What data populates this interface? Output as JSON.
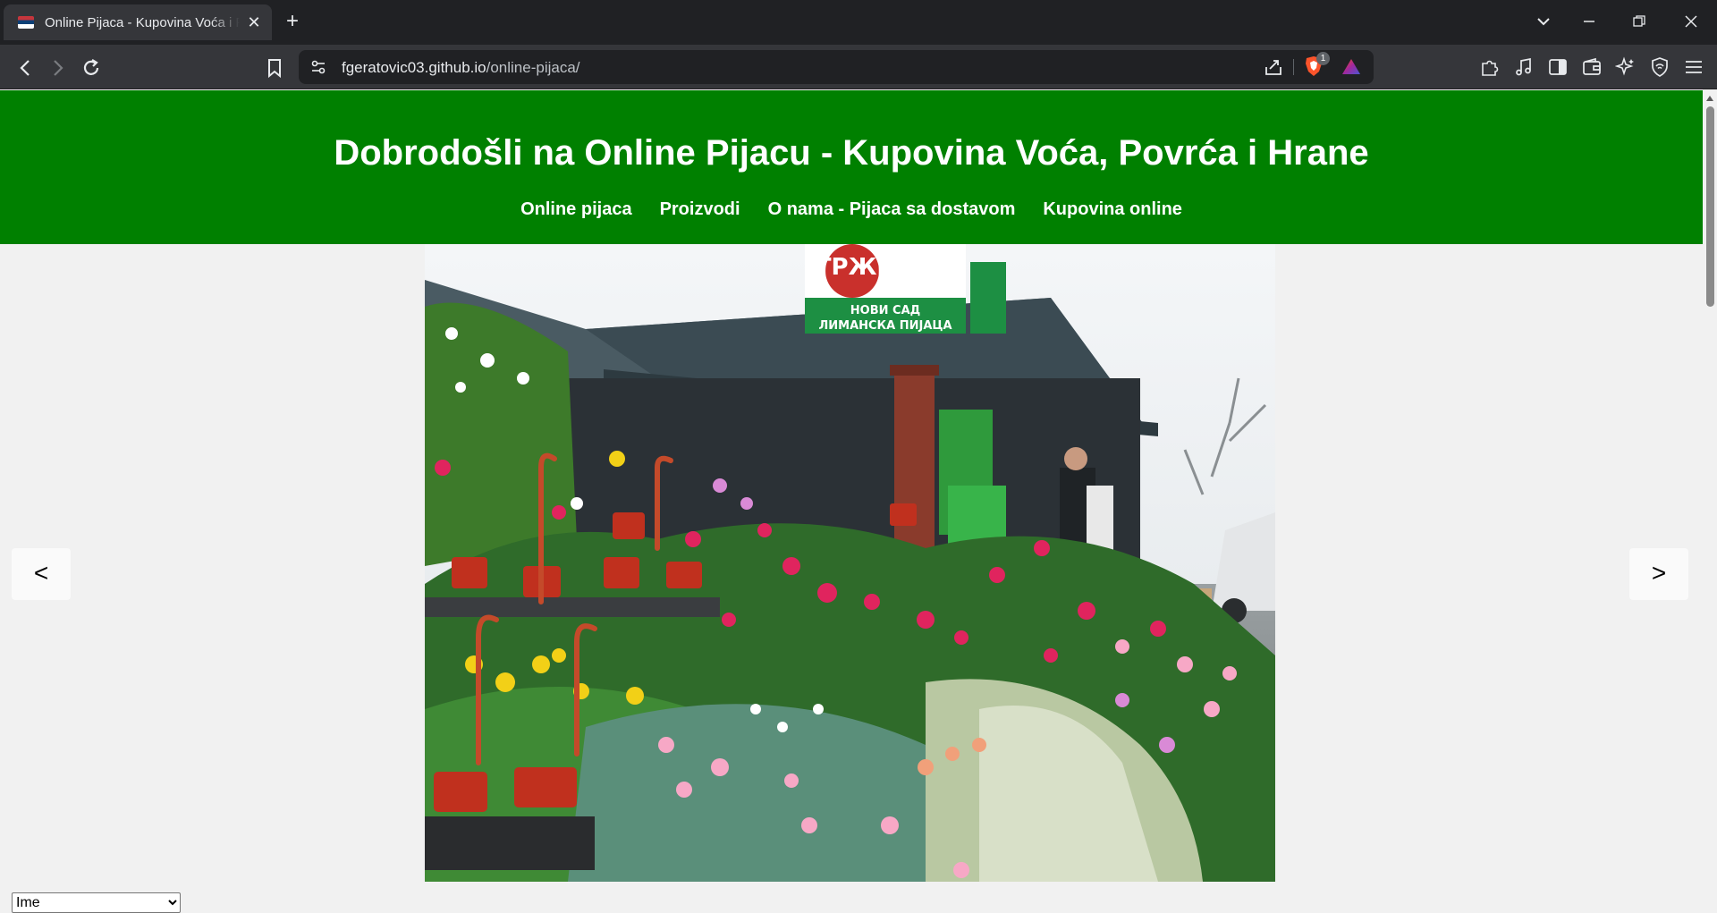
{
  "browser": {
    "tab_title": "Online Pijaca - Kupovina Voća i Povrća i Hrane",
    "tab_close": "✕",
    "new_tab": "+",
    "url_host": "fgeratovic03.github.io",
    "url_path": "/online-pijaca/",
    "shield_count": "1",
    "nav_back": "‹",
    "nav_forward": "›",
    "reload": "↻",
    "tab_list": "⌄",
    "minimize": "—",
    "restore": "❐",
    "close": "✕"
  },
  "site": {
    "title": "Dobrodošli na Online Pijacu - Kupovina Voća, Povrća i Hrane",
    "nav": [
      {
        "label": "Online pijaca"
      },
      {
        "label": "Proizvodi"
      },
      {
        "label": "O nama - Pijaca sa dostavom"
      },
      {
        "label": "Kupovina online"
      }
    ]
  },
  "slider": {
    "prev_label": "<",
    "next_label": ">",
    "sign_line1": "ТРЖНИЦА",
    "sign_line2": "НОВИ САД",
    "sign_line3": "ЛИМАНСКА ПИЈАЦА",
    "image_alt": "Limanska pijaca - cvećara"
  },
  "sort": {
    "selected": "Ime"
  },
  "colors": {
    "header_green": "#008000",
    "page_bg": "#f1f1f1",
    "chrome_dark": "#202124",
    "chrome_toolbar": "#35363a"
  }
}
